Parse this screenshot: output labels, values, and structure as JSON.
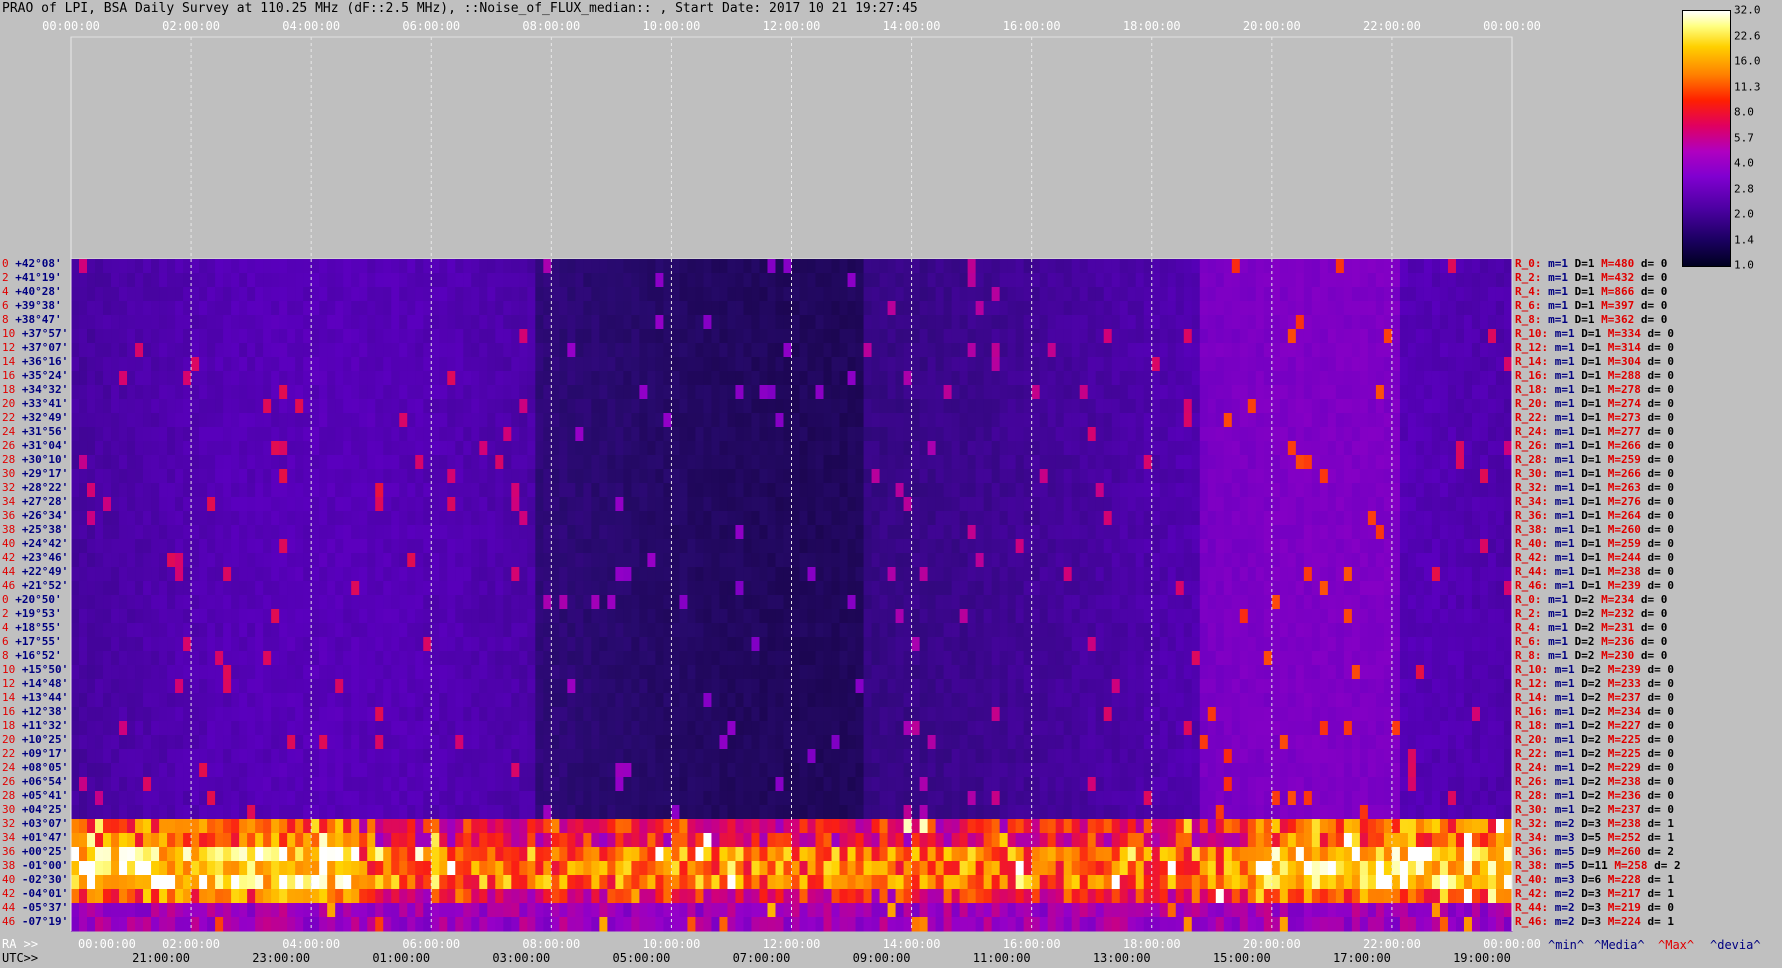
{
  "title": "PRAO of LPI, BSA Daily Survey at 110.25 MHz (dF::2.5 MHz), ::Noise_of_FLUX_median:: , Start Date: 2017 10 21 19:27:45",
  "chart_data": {
    "type": "heatmap",
    "title": "PRAO of LPI, BSA Daily Survey at 110.25 MHz (dF::2.5 MHz), ::Noise_of_FLUX_median:: , Start Date: 2017 10 21 19:27:45",
    "x_top_ticks": [
      "00:00:00",
      "02:00:00",
      "04:00:00",
      "06:00:00",
      "08:00:00",
      "10:00:00",
      "12:00:00",
      "14:00:00",
      "16:00:00",
      "18:00:00",
      "20:00:00",
      "22:00:00",
      "00:00:00"
    ],
    "ra_label": "RA >>",
    "ra_ticks": [
      "00:00:00",
      "02:00:00",
      "04:00:00",
      "06:00:00",
      "08:00:00",
      "10:00:00",
      "12:00:00",
      "14:00:00",
      "16:00:00",
      "18:00:00",
      "20:00:00",
      "22:00:00",
      "00:00:00"
    ],
    "utc_label": "UTC>>",
    "utc_ticks": [
      "21:00:00",
      "23:00:00",
      "01:00:00",
      "03:00:00",
      "05:00:00",
      "07:00:00",
      "09:00:00",
      "11:00:00",
      "13:00:00",
      "15:00:00",
      "17:00:00",
      "19:00:00"
    ],
    "dec_rows": [
      {
        "i": "0",
        "dec": "+42°08'"
      },
      {
        "i": "2",
        "dec": "+41°19'"
      },
      {
        "i": "4",
        "dec": "+40°28'"
      },
      {
        "i": "6",
        "dec": "+39°38'"
      },
      {
        "i": "8",
        "dec": "+38°47'"
      },
      {
        "i": "10",
        "dec": "+37°57'"
      },
      {
        "i": "12",
        "dec": "+37°07'"
      },
      {
        "i": "14",
        "dec": "+36°16'"
      },
      {
        "i": "16",
        "dec": "+35°24'"
      },
      {
        "i": "18",
        "dec": "+34°32'"
      },
      {
        "i": "20",
        "dec": "+33°41'"
      },
      {
        "i": "22",
        "dec": "+32°49'"
      },
      {
        "i": "24",
        "dec": "+31°56'"
      },
      {
        "i": "26",
        "dec": "+31°04'"
      },
      {
        "i": "28",
        "dec": "+30°10'"
      },
      {
        "i": "30",
        "dec": "+29°17'"
      },
      {
        "i": "32",
        "dec": "+28°22'"
      },
      {
        "i": "34",
        "dec": "+27°28'"
      },
      {
        "i": "36",
        "dec": "+26°34'"
      },
      {
        "i": "38",
        "dec": "+25°38'"
      },
      {
        "i": "40",
        "dec": "+24°42'"
      },
      {
        "i": "42",
        "dec": "+23°46'"
      },
      {
        "i": "44",
        "dec": "+22°49'"
      },
      {
        "i": "46",
        "dec": "+21°52'"
      },
      {
        "i": "0",
        "dec": "+20°50'"
      },
      {
        "i": "2",
        "dec": "+19°53'"
      },
      {
        "i": "4",
        "dec": "+18°55'"
      },
      {
        "i": "6",
        "dec": "+17°55'"
      },
      {
        "i": "8",
        "dec": "+16°52'"
      },
      {
        "i": "10",
        "dec": "+15°50'"
      },
      {
        "i": "12",
        "dec": "+14°48'"
      },
      {
        "i": "14",
        "dec": "+13°44'"
      },
      {
        "i": "16",
        "dec": "+12°38'"
      },
      {
        "i": "18",
        "dec": "+11°32'"
      },
      {
        "i": "20",
        "dec": "+10°25'"
      },
      {
        "i": "22",
        "dec": "+09°17'"
      },
      {
        "i": "24",
        "dec": "+08°05'"
      },
      {
        "i": "26",
        "dec": "+06°54'"
      },
      {
        "i": "28",
        "dec": "+05°41'"
      },
      {
        "i": "30",
        "dec": "+04°25'"
      },
      {
        "i": "32",
        "dec": "+03°07'"
      },
      {
        "i": "34",
        "dec": "+01°47'"
      },
      {
        "i": "36",
        "dec": "+00°25'"
      },
      {
        "i": "38",
        "dec": "-01°00'"
      },
      {
        "i": "40",
        "dec": "-02°30'"
      },
      {
        "i": "42",
        "dec": "-04°01'"
      },
      {
        "i": "44",
        "dec": "-05°37'"
      },
      {
        "i": "46",
        "dec": "-07°19'"
      }
    ],
    "row_stats": [
      {
        "r": "R_0:",
        "m": "m=1",
        "D": "D=1",
        "M": "M=480",
        "d": "d= 0"
      },
      {
        "r": "R_2:",
        "m": "m=1",
        "D": "D=1",
        "M": "M=432",
        "d": "d= 0"
      },
      {
        "r": "R_4:",
        "m": "m=1",
        "D": "D=1",
        "M": "M=866",
        "d": "d= 0"
      },
      {
        "r": "R_6:",
        "m": "m=1",
        "D": "D=1",
        "M": "M=397",
        "d": "d= 0"
      },
      {
        "r": "R_8:",
        "m": "m=1",
        "D": "D=1",
        "M": "M=362",
        "d": "d= 0"
      },
      {
        "r": "R_10:",
        "m": "m=1",
        "D": "D=1",
        "M": "M=334",
        "d": "d= 0"
      },
      {
        "r": "R_12:",
        "m": "m=1",
        "D": "D=1",
        "M": "M=314",
        "d": "d= 0"
      },
      {
        "r": "R_14:",
        "m": "m=1",
        "D": "D=1",
        "M": "M=304",
        "d": "d= 0"
      },
      {
        "r": "R_16:",
        "m": "m=1",
        "D": "D=1",
        "M": "M=288",
        "d": "d= 0"
      },
      {
        "r": "R_18:",
        "m": "m=1",
        "D": "D=1",
        "M": "M=278",
        "d": "d= 0"
      },
      {
        "r": "R_20:",
        "m": "m=1",
        "D": "D=1",
        "M": "M=274",
        "d": "d= 0"
      },
      {
        "r": "R_22:",
        "m": "m=1",
        "D": "D=1",
        "M": "M=273",
        "d": "d= 0"
      },
      {
        "r": "R_24:",
        "m": "m=1",
        "D": "D=1",
        "M": "M=277",
        "d": "d= 0"
      },
      {
        "r": "R_26:",
        "m": "m=1",
        "D": "D=1",
        "M": "M=266",
        "d": "d= 0"
      },
      {
        "r": "R_28:",
        "m": "m=1",
        "D": "D=1",
        "M": "M=259",
        "d": "d= 0"
      },
      {
        "r": "R_30:",
        "m": "m=1",
        "D": "D=1",
        "M": "M=266",
        "d": "d= 0"
      },
      {
        "r": "R_32:",
        "m": "m=1",
        "D": "D=1",
        "M": "M=263",
        "d": "d= 0"
      },
      {
        "r": "R_34:",
        "m": "m=1",
        "D": "D=1",
        "M": "M=276",
        "d": "d= 0"
      },
      {
        "r": "R_36:",
        "m": "m=1",
        "D": "D=1",
        "M": "M=264",
        "d": "d= 0"
      },
      {
        "r": "R_38:",
        "m": "m=1",
        "D": "D=1",
        "M": "M=260",
        "d": "d= 0"
      },
      {
        "r": "R_40:",
        "m": "m=1",
        "D": "D=1",
        "M": "M=259",
        "d": "d= 0"
      },
      {
        "r": "R_42:",
        "m": "m=1",
        "D": "D=1",
        "M": "M=244",
        "d": "d= 0"
      },
      {
        "r": "R_44:",
        "m": "m=1",
        "D": "D=1",
        "M": "M=238",
        "d": "d= 0"
      },
      {
        "r": "R_46:",
        "m": "m=1",
        "D": "D=1",
        "M": "M=239",
        "d": "d= 0"
      },
      {
        "r": "R_0:",
        "m": "m=1",
        "D": "D=2",
        "M": "M=234",
        "d": "d= 0"
      },
      {
        "r": "R_2:",
        "m": "m=1",
        "D": "D=2",
        "M": "M=232",
        "d": "d= 0"
      },
      {
        "r": "R_4:",
        "m": "m=1",
        "D": "D=2",
        "M": "M=231",
        "d": "d= 0"
      },
      {
        "r": "R_6:",
        "m": "m=1",
        "D": "D=2",
        "M": "M=236",
        "d": "d= 0"
      },
      {
        "r": "R_8:",
        "m": "m=1",
        "D": "D=2",
        "M": "M=230",
        "d": "d= 0"
      },
      {
        "r": "R_10:",
        "m": "m=1",
        "D": "D=2",
        "M": "M=239",
        "d": "d= 0"
      },
      {
        "r": "R_12:",
        "m": "m=1",
        "D": "D=2",
        "M": "M=233",
        "d": "d= 0"
      },
      {
        "r": "R_14:",
        "m": "m=1",
        "D": "D=2",
        "M": "M=237",
        "d": "d= 0"
      },
      {
        "r": "R_16:",
        "m": "m=1",
        "D": "D=2",
        "M": "M=234",
        "d": "d= 0"
      },
      {
        "r": "R_18:",
        "m": "m=1",
        "D": "D=2",
        "M": "M=227",
        "d": "d= 0"
      },
      {
        "r": "R_20:",
        "m": "m=1",
        "D": "D=2",
        "M": "M=225",
        "d": "d= 0"
      },
      {
        "r": "R_22:",
        "m": "m=1",
        "D": "D=2",
        "M": "M=225",
        "d": "d= 0"
      },
      {
        "r": "R_24:",
        "m": "m=1",
        "D": "D=2",
        "M": "M=229",
        "d": "d= 0"
      },
      {
        "r": "R_26:",
        "m": "m=1",
        "D": "D=2",
        "M": "M=238",
        "d": "d= 0"
      },
      {
        "r": "R_28:",
        "m": "m=1",
        "D": "D=2",
        "M": "M=236",
        "d": "d= 0"
      },
      {
        "r": "R_30:",
        "m": "m=1",
        "D": "D=2",
        "M": "M=237",
        "d": "d= 0"
      },
      {
        "r": "R_32:",
        "m": "m=2",
        "D": "D=3",
        "M": "M=238",
        "d": "d= 1"
      },
      {
        "r": "R_34:",
        "m": "m=3",
        "D": "D=5",
        "M": "M=252",
        "d": "d= 1"
      },
      {
        "r": "R_36:",
        "m": "m=5",
        "D": "D=9",
        "M": "M=260",
        "d": "d= 2"
      },
      {
        "r": "R_38:",
        "m": "m=5",
        "D": "D=11",
        "M": "M=258",
        "d": "d= 2"
      },
      {
        "r": "R_40:",
        "m": "m=3",
        "D": "D=6",
        "M": "M=228",
        "d": "d= 1"
      },
      {
        "r": "R_42:",
        "m": "m=2",
        "D": "D=3",
        "M": "M=217",
        "d": "d= 1"
      },
      {
        "r": "R_44:",
        "m": "m=2",
        "D": "D=3",
        "M": "M=219",
        "d": "d= 0"
      },
      {
        "r": "R_46:",
        "m": "m=2",
        "D": "D=3",
        "M": "M=224",
        "d": "d= 1"
      }
    ],
    "legend_labels": {
      "min": "^min^",
      "media": "^Media^",
      "max": "^Max^",
      "devia": "^devia^"
    },
    "legend_colors": {
      "min": "#000080",
      "media": "#000080",
      "max": "#e00000",
      "devia": "#000080"
    },
    "colorbar_ticks": [
      "32.0",
      "22.6",
      "16.0",
      "11.3",
      "8.0",
      "5.7",
      "4.0",
      "2.8",
      "2.0",
      "1.4",
      "1.0"
    ],
    "colorbar_range": [
      1.0,
      32.0
    ],
    "colormap": "gnuplot",
    "grid": true
  }
}
